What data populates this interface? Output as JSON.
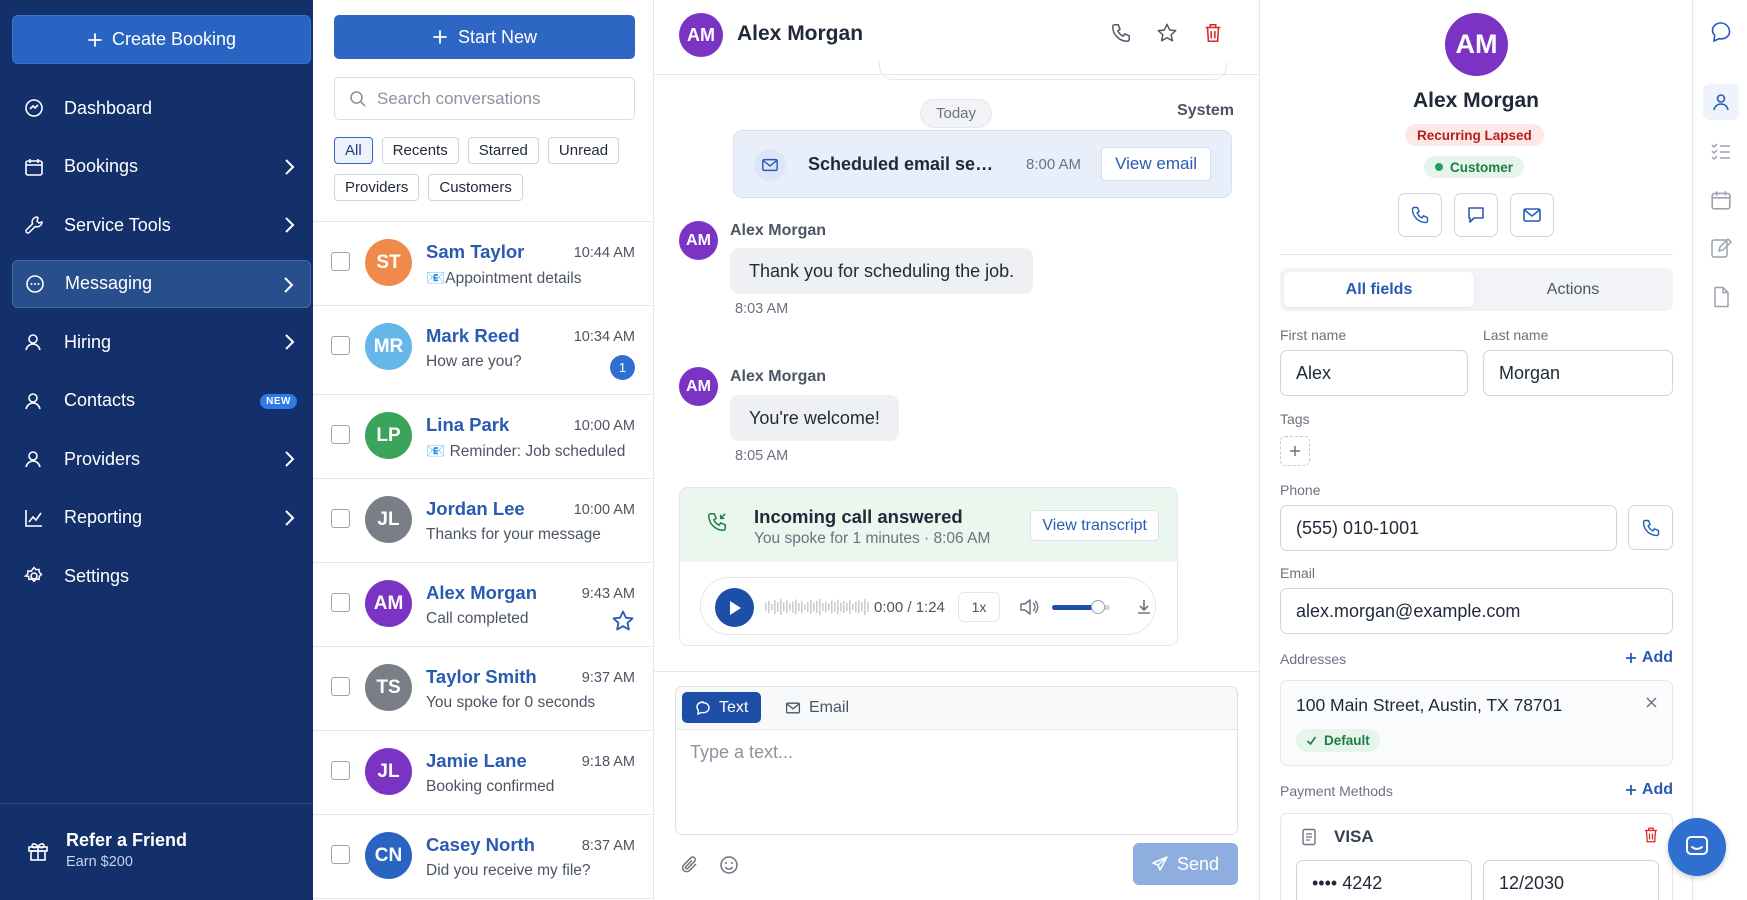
{
  "sidebar": {
    "create_booking": "Create Booking",
    "items": [
      {
        "label": "Dashboard",
        "icon": "dashboard-icon"
      },
      {
        "label": "Bookings",
        "icon": "calendar-icon"
      },
      {
        "label": "Service Tools",
        "icon": "wrench-icon"
      },
      {
        "label": "Messaging",
        "icon": "chat-icon"
      },
      {
        "label": "Hiring",
        "icon": "person-icon"
      },
      {
        "label": "Contacts",
        "icon": "contacts-icon",
        "badge": "NEW"
      },
      {
        "label": "Providers",
        "icon": "providers-icon"
      },
      {
        "label": "Reporting",
        "icon": "chart-icon"
      },
      {
        "label": "Settings",
        "icon": "gear-icon"
      }
    ],
    "refer_title": "Refer a Friend",
    "refer_sub": "Earn $200"
  },
  "conversations": {
    "start_new": "Start New",
    "search_placeholder": "Search conversations",
    "filters": [
      "All",
      "Recents",
      "Starred",
      "Unread",
      "Providers",
      "Customers"
    ],
    "items": [
      {
        "initials": "ST",
        "name": "Sam Taylor",
        "time": "10:44 AM",
        "preview": "📧Appointment details",
        "color": "#f08a4b"
      },
      {
        "initials": "MR",
        "name": "Mark Reed",
        "time": "10:34 AM",
        "preview": "How are you?",
        "color": "#64b7e8",
        "unread": "1"
      },
      {
        "initials": "LP",
        "name": "Lina Park",
        "time": "10:00 AM",
        "preview": "📧 Reminder: Job scheduled",
        "color": "#3aa55a"
      },
      {
        "initials": "JL",
        "name": "Jordan Lee",
        "time": "10:00 AM",
        "preview": "Thanks for your message",
        "color": "#7a7f87"
      },
      {
        "initials": "AM",
        "name": "Alex Morgan",
        "time": "9:43 AM",
        "preview": "Call completed",
        "color": "#7b33c4",
        "starred": true
      },
      {
        "initials": "TS",
        "name": "Taylor Smith",
        "time": "9:37 AM",
        "preview": "You spoke for 0 seconds",
        "color": "#7a7f87"
      },
      {
        "initials": "JL",
        "name": "Jamie Lane",
        "time": "9:18 AM",
        "preview": "Booking confirmed",
        "color": "#7b33c4"
      },
      {
        "initials": "CN",
        "name": "Casey North",
        "time": "8:37 AM",
        "preview": "Did you receive my file?",
        "color": "#2a64c2"
      }
    ]
  },
  "chat": {
    "initials": "AM",
    "name": "Alex Morgan",
    "today": "Today",
    "system": "System",
    "scheduled": {
      "title": "Scheduled email sent to Alex Morgan",
      "time": "8:00 AM",
      "button": "View email"
    },
    "messages": [
      {
        "initials": "AM",
        "sender": "Alex Morgan",
        "text": "Thank you for scheduling the job.",
        "time": "8:03 AM"
      },
      {
        "initials": "AM",
        "sender": "Alex Morgan",
        "text": "You're welcome!",
        "time": "8:05 AM"
      }
    ],
    "call": {
      "title": "Incoming call answered",
      "subtitle": "You spoke for 1 minutes · 8:06 AM",
      "button": "View transcript",
      "time": "0:00 / 1:24",
      "speed": "1x",
      "volume": 0.8
    },
    "composer": {
      "tab_text": "Text",
      "tab_email": "Email",
      "placeholder": "Type a text...",
      "send": "Send"
    }
  },
  "contact": {
    "initials": "AM",
    "name": "Alex Morgan",
    "tag_status": "Recurring Lapsed",
    "tag_type": "Customer",
    "tab_fields": "All fields",
    "tab_actions": "Actions",
    "first_name_label": "First name",
    "first_name": "Alex",
    "last_name_label": "Last name",
    "last_name": "Morgan",
    "tags_label": "Tags",
    "phone_label": "Phone",
    "phone": "(555) 010-1001",
    "email_label": "Email",
    "email": "alex.morgan@example.com",
    "addresses_label": "Addresses",
    "add": "Add",
    "address": "100 Main Street, Austin, TX 78701",
    "address_default": "Default",
    "payment_label": "Payment Methods",
    "card_brand": "VISA",
    "card_number": "•••• 4242",
    "card_expiry": "12/2030"
  },
  "colors": {
    "sidebar": "#13306b",
    "accent": "#2d67c3",
    "avatar_purple": "#7b33c4"
  }
}
